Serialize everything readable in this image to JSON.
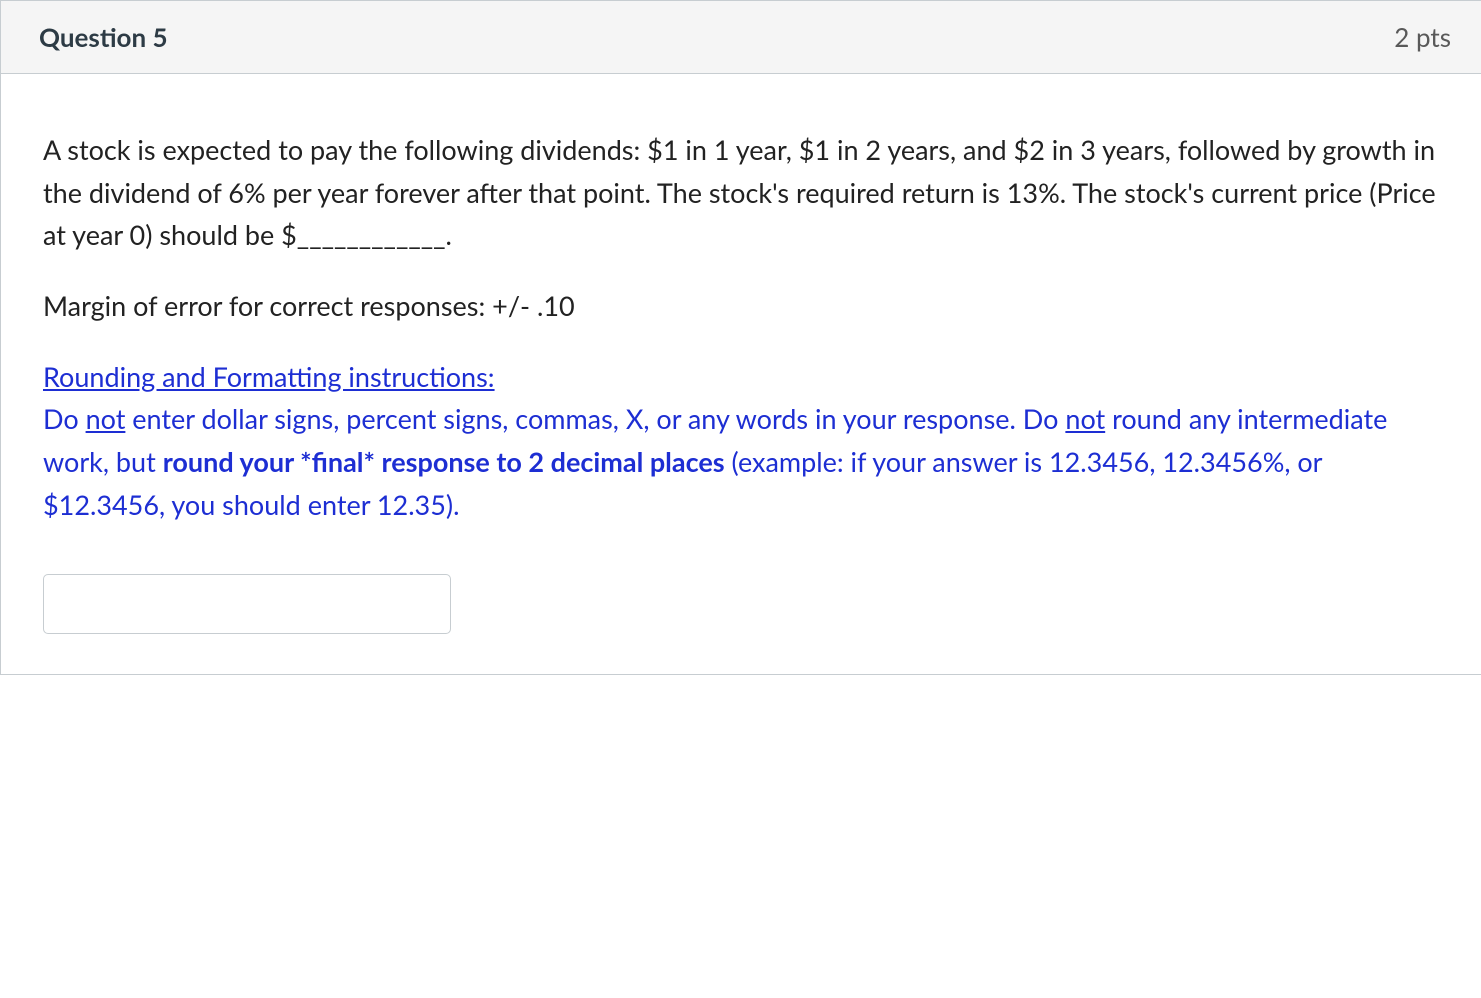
{
  "header": {
    "title": "Question 5",
    "points": "2 pts"
  },
  "body": {
    "para1": "A stock is expected to pay the following dividends: $1 in 1 year, $1 in 2 years, and $2 in 3 years, followed by growth in the dividend of 6% per year forever after that point. The stock's required return is 13%. The stock's current price (Price at year 0) should be $____________.",
    "para2": "Margin of error for correct responses: +/- .10",
    "instructions": {
      "heading": "Rounding and Formatting instructions:",
      "seg1": "Do ",
      "seg2_not": "not",
      "seg3": " enter dollar signs, percent signs, commas, X, or any words in your response. Do ",
      "seg4_not": "not",
      "seg5": " round any intermediate work, but ",
      "seg6_bold": "round your *final* response to 2 decimal places",
      "seg7": " (example: if your answer is 12.3456, 12.3456%, or $12.3456, you should enter 12.35)."
    }
  },
  "answer": {
    "value": ""
  }
}
